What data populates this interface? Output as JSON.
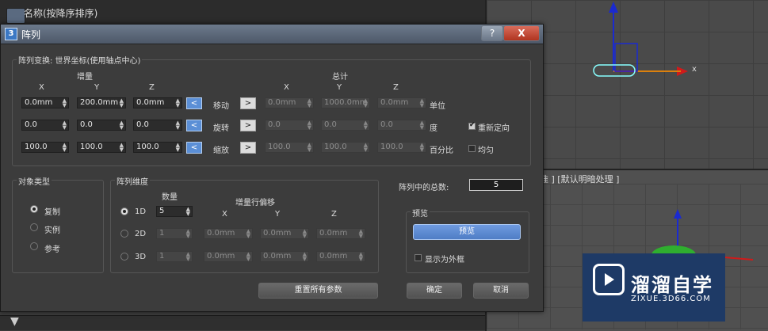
{
  "scene": {
    "header": "名称(按降序排序)"
  },
  "viewport_br": {
    "label": "标准 ] [默认明暗处理 ]"
  },
  "viewport_tr": {
    "axis_label": "x"
  },
  "logo": {
    "title": "溜溜自学",
    "subtitle": "ZIXUE.3D66.COM"
  },
  "dialog": {
    "title": "阵列",
    "title_icon": "3",
    "help_label": "?",
    "close_label": "X",
    "transform": {
      "group_label": "阵列变换: 世界坐标(使用轴点中心)",
      "increment_label": "增量",
      "total_label": "总计",
      "axes": [
        "X",
        "Y",
        "Z"
      ],
      "rows": [
        {
          "name": "移动",
          "inc": [
            "0.0mm",
            "200.0mm",
            "0.0mm"
          ],
          "total": [
            "0.0mm",
            "1000.0mm",
            "0.0mm"
          ],
          "unit": "单位"
        },
        {
          "name": "旋转",
          "inc": [
            "0.0",
            "0.0",
            "0.0"
          ],
          "total": [
            "0.0",
            "0.0",
            "0.0"
          ],
          "unit": "度"
        },
        {
          "name": "缩放",
          "inc": [
            "100.0",
            "100.0",
            "100.0"
          ],
          "total": [
            "100.0",
            "100.0",
            "100.0"
          ],
          "unit": "百分比"
        }
      ],
      "left_arrow": "<",
      "right_arrow": ">",
      "reorient_label": "重新定向",
      "reorient_checked": true,
      "uniform_label": "均匀",
      "uniform_checked": false
    },
    "object_type": {
      "group_label": "对象类型",
      "options": [
        "复制",
        "实例",
        "参考"
      ],
      "selected": 0
    },
    "dimensions": {
      "group_label": "阵列维度",
      "count_label": "数量",
      "offset_label": "增量行偏移",
      "axes": [
        "X",
        "Y",
        "Z"
      ],
      "rows": [
        {
          "label": "1D",
          "count": "5",
          "offsets": []
        },
        {
          "label": "2D",
          "count": "1",
          "offsets": [
            "0.0mm",
            "0.0mm",
            "0.0mm"
          ]
        },
        {
          "label": "3D",
          "count": "1",
          "offsets": [
            "0.0mm",
            "0.0mm",
            "0.0mm"
          ]
        }
      ]
    },
    "total": {
      "label": "阵列中的总数:",
      "value": "5"
    },
    "preview": {
      "group_label": "预览",
      "button": "预览",
      "box_label": "显示为外框",
      "box_checked": false
    },
    "reset_label": "重置所有参数",
    "ok_label": "确定",
    "cancel_label": "取消"
  }
}
